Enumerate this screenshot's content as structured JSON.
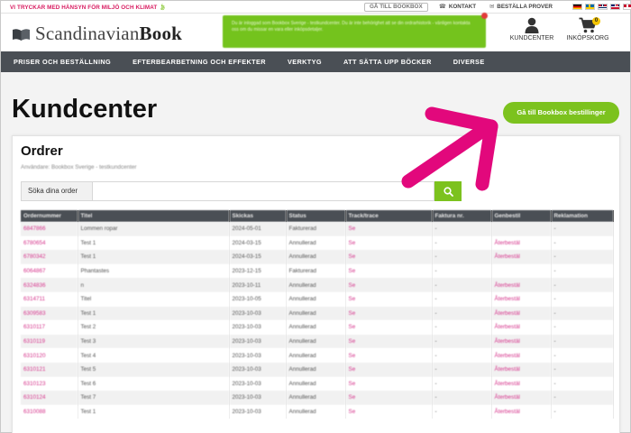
{
  "topbar": {
    "tagline": "VI TRYCKAR MED HÄNSYN FÖR MILJÖ OCH KLIMAT",
    "bookbox_link": "GÅ TILL BOOKBOX",
    "contact": "KONTAKT",
    "order_samples": "BESTÄLLA PROVER",
    "flags": [
      "de",
      "se",
      "no",
      "gb",
      "dk"
    ]
  },
  "header": {
    "logo_light": "Scandinavian",
    "logo_bold": "Book",
    "notice_text": "Du är inloggad som Bookbox Sverige - testkundcenter. Du är inte behörighet att se din ordrarhistorik - vänligen kontakta oss om du missar en vara eller inköpsdetaljer.",
    "kundcenter_label": "KUNDCENTER",
    "cart_label": "INKÖPSKORG",
    "cart_count": "0"
  },
  "nav": {
    "items": [
      "PRISER OCH BESTÄLLNING",
      "EFTERBEARBETNING OCH EFFEKTER",
      "VERKTYG",
      "ATT SÄTTA UPP BÖCKER",
      "DIVERSE"
    ]
  },
  "page": {
    "title": "Kundcenter",
    "bookbox_orders_button": "Gå till Bookbox bestillinger"
  },
  "orders": {
    "title": "Ordrer",
    "subtitle": "Användare: Bookbox Sverige - testkundcenter",
    "search_label": "Söka dina order",
    "search_placeholder": "",
    "columns": [
      "Ordernummer",
      "Titel",
      "Skickas",
      "Status",
      "Track/trace",
      "Faktura nr.",
      "Genbestil",
      "Reklamation"
    ],
    "rows": [
      [
        "6847866",
        "Lommen ropar",
        "2024-05-01",
        "Fakturerad",
        "Se",
        "-",
        "",
        "-"
      ],
      [
        "6780654",
        "Test 1",
        "2024-03-15",
        "Annullerad",
        "Se",
        "-",
        "Återbestäl",
        "-"
      ],
      [
        "6780342",
        "Test 1",
        "2024-03-15",
        "Annullerad",
        "Se",
        "-",
        "Återbestäl",
        "-"
      ],
      [
        "6064867",
        "Phantastes",
        "2023-12-15",
        "Fakturerad",
        "Se",
        "-",
        "",
        "-"
      ],
      [
        "6324836",
        "n",
        "2023-10-11",
        "Annullerad",
        "Se",
        "-",
        "Återbestäl",
        "-"
      ],
      [
        "6314711",
        "Titel",
        "2023-10-05",
        "Annullerad",
        "Se",
        "-",
        "Återbestäl",
        "-"
      ],
      [
        "6309583",
        "Test 1",
        "2023-10-03",
        "Annullerad",
        "Se",
        "-",
        "Återbestäl",
        "-"
      ],
      [
        "6310117",
        "Test 2",
        "2023-10-03",
        "Annullerad",
        "Se",
        "-",
        "Återbestäl",
        "-"
      ],
      [
        "6310119",
        "Test 3",
        "2023-10-03",
        "Annullerad",
        "Se",
        "-",
        "Återbestäl",
        "-"
      ],
      [
        "6310120",
        "Test 4",
        "2023-10-03",
        "Annullerad",
        "Se",
        "-",
        "Återbestäl",
        "-"
      ],
      [
        "6310121",
        "Test 5",
        "2023-10-03",
        "Annullerad",
        "Se",
        "-",
        "Återbestäl",
        "-"
      ],
      [
        "6310123",
        "Test 6",
        "2023-10-03",
        "Annullerad",
        "Se",
        "-",
        "Återbestäl",
        "-"
      ],
      [
        "6310124",
        "Test 7",
        "2023-10-03",
        "Annullerad",
        "Se",
        "-",
        "Återbestäl",
        "-"
      ],
      [
        "6310088",
        "Test 1",
        "2023-10-03",
        "Annullerad",
        "Se",
        "-",
        "Återbestäl",
        "-"
      ]
    ]
  },
  "colors": {
    "brand_green": "#7cc21e",
    "nav_dark": "#4a4f55",
    "link_pink": "#d6358c",
    "annotation_arrow": "#e2087c"
  },
  "icons": [
    "leaf-icon",
    "phone-icon",
    "mail-icon",
    "book-logo-icon",
    "user-icon",
    "cart-icon",
    "search-icon",
    "arrow-annotation-icon"
  ]
}
